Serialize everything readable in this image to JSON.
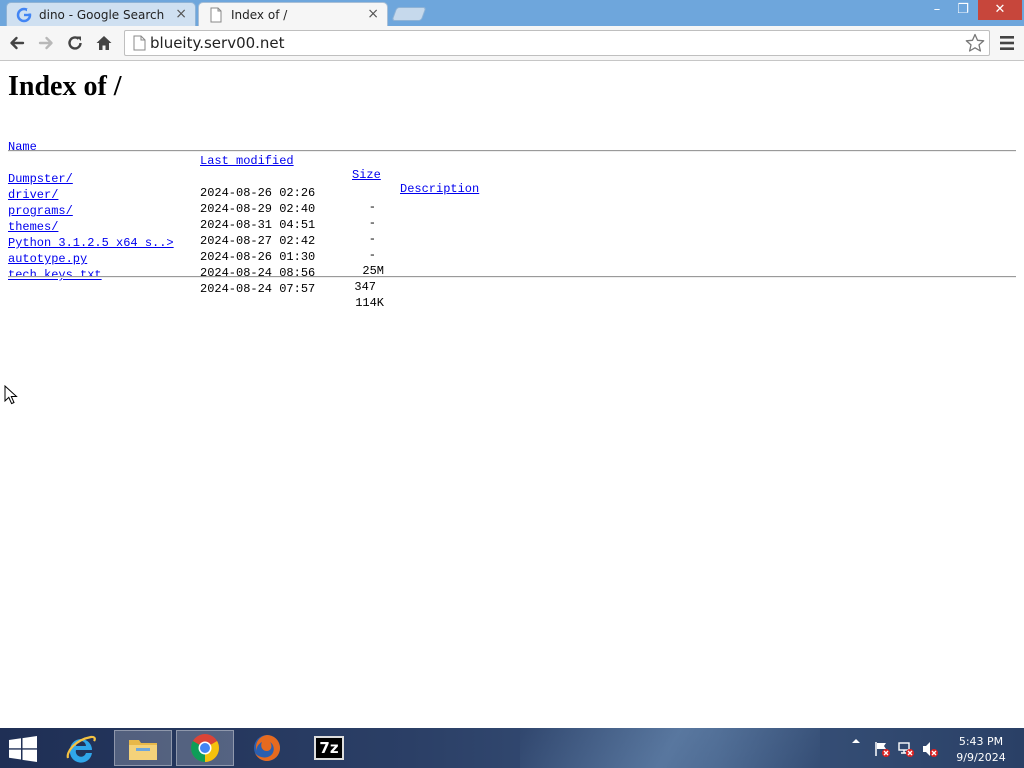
{
  "browser": {
    "tabs": [
      {
        "title": "dino - Google Search",
        "icon": "google-icon",
        "active": false
      },
      {
        "title": "Index of /",
        "icon": "page-icon",
        "active": true
      }
    ],
    "tab_close_glyph": "×",
    "url": "blueity.serv00.net",
    "window_controls": {
      "minimize": "–",
      "maximize": "❐",
      "close": "✕"
    }
  },
  "page": {
    "title": "Index of /",
    "columns": {
      "name": "Name",
      "modified": "Last modified",
      "size": "Size",
      "description": "Description"
    },
    "rows": [
      {
        "name": "Dumpster/",
        "modified": "2024-08-26 02:26",
        "size": "-"
      },
      {
        "name": "driver/",
        "modified": "2024-08-29 02:40",
        "size": "-"
      },
      {
        "name": "programs/",
        "modified": "2024-08-31 04:51",
        "size": "-"
      },
      {
        "name": "themes/",
        "modified": "2024-08-27 02:42",
        "size": "-"
      },
      {
        "name": "Python 3.1.2.5 x64 s..>",
        "modified": "2024-08-26 01:30",
        "size": "25M"
      },
      {
        "name": "autotype.py",
        "modified": "2024-08-24 08:56",
        "size": "347"
      },
      {
        "name": "tech keys.txt",
        "modified": "2024-08-24 07:57",
        "size": "114K"
      }
    ]
  },
  "taskbar": {
    "items": [
      "internet-explorer-icon",
      "file-explorer-icon",
      "chrome-icon",
      "firefox-icon",
      "7zip-icon"
    ],
    "zip_label": "7z",
    "clock_time": "5:43 PM",
    "clock_date": "9/9/2024"
  },
  "colors": {
    "link": "#0000ee",
    "titlebar": "#6ea6dc",
    "close_button": "#c7463b"
  }
}
